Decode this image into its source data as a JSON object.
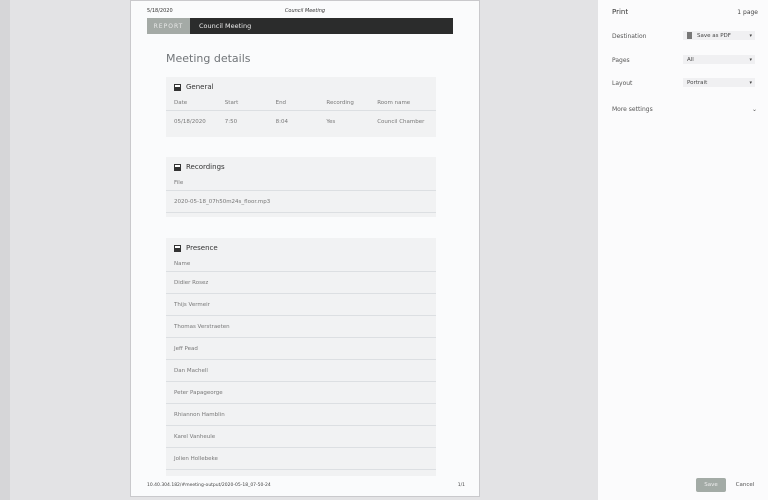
{
  "page": {
    "date": "5/18/2020",
    "doc_title": "Council Meeting",
    "tag": "REPORT",
    "bar_title": "Council Meeting",
    "heading": "Meeting details",
    "general": {
      "title": "General",
      "headers": [
        "Date",
        "Start",
        "End",
        "Recording",
        "Room name"
      ],
      "values": [
        "05/18/2020",
        "7:50",
        "8:04",
        "Yes",
        "Council Chamber"
      ]
    },
    "recordings": {
      "title": "Recordings",
      "header": "File",
      "file": "2020-05-18_07h50m24s_floor.mp3"
    },
    "presence": {
      "title": "Presence",
      "header": "Name",
      "names": [
        "Didier Rosez",
        "Thijs Vermeir",
        "Thomas Verstraeten",
        "Jeff Pead",
        "Dan Machell",
        "Peter Papageorge",
        "Rhiannon Hamblin",
        "Karel Vanheule",
        "Jolien Hollebeke"
      ]
    },
    "footer_url": "10.40.304.182/#meeting-output/2020-05-18_07-50-24",
    "footer_page": "1/1"
  },
  "print": {
    "title": "Print",
    "page_count": "1 page",
    "destination_label": "Destination",
    "destination_value": "Save as PDF",
    "pages_label": "Pages",
    "pages_value": "All",
    "layout_label": "Layout",
    "layout_value": "Portrait",
    "more_settings": "More settings",
    "save": "Save",
    "cancel": "Cancel"
  }
}
